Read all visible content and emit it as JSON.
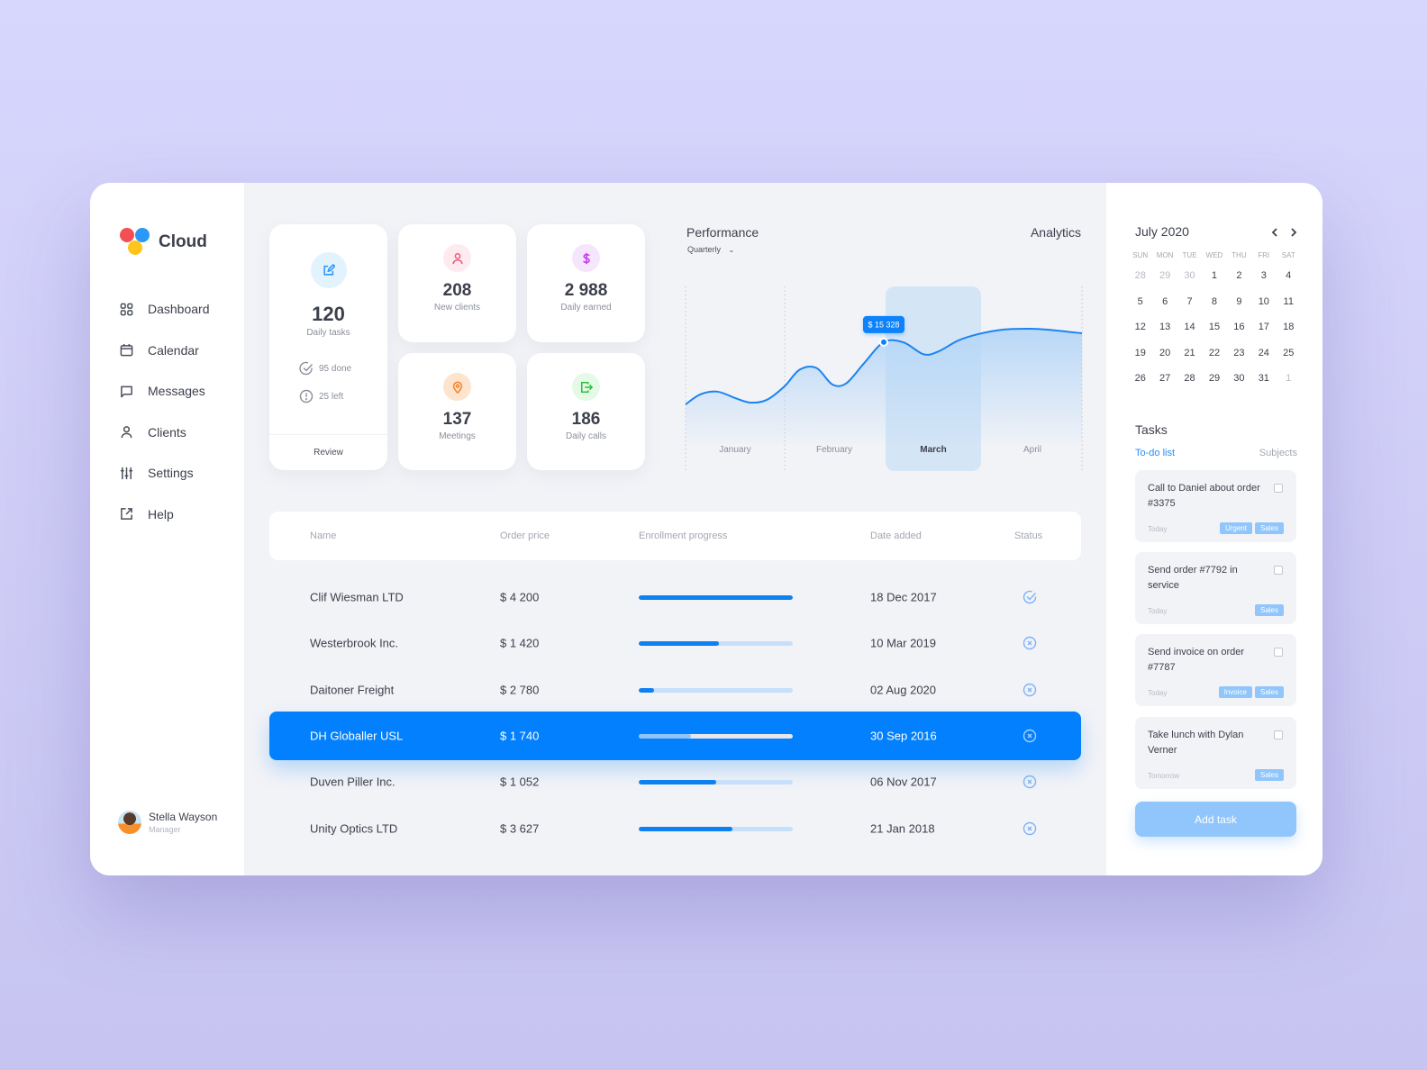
{
  "app": {
    "name": "Cloud"
  },
  "sidebar": {
    "items": [
      {
        "label": "Dashboard",
        "icon": "grid-icon"
      },
      {
        "label": "Calendar",
        "icon": "calendar-icon"
      },
      {
        "label": "Messages",
        "icon": "message-icon"
      },
      {
        "label": "Clients",
        "icon": "user-icon"
      },
      {
        "label": "Settings",
        "icon": "sliders-icon"
      },
      {
        "label": "Help",
        "icon": "external-link-icon"
      }
    ],
    "user": {
      "name": "Stella Wayson",
      "role": "Manager"
    }
  },
  "stats": {
    "daily_tasks": {
      "value": "120",
      "label": "Daily tasks",
      "done": "95 done",
      "left": "25 left",
      "review": "Review"
    },
    "new_clients": {
      "value": "208",
      "label": "New clients"
    },
    "daily_earned": {
      "value": "2 988",
      "label": "Daily earned"
    },
    "meetings": {
      "value": "137",
      "label": "Meetings"
    },
    "daily_calls": {
      "value": "186",
      "label": "Daily calls"
    }
  },
  "colors": {
    "accent": "#0380fd",
    "tag": "#90c6fb",
    "tasks_icon_bg": "#e3f3fe",
    "clients_icon_bg": "#fdebf0",
    "earned_icon_bg": "#f6e6fd",
    "meetings_icon_bg": "#fde4cf",
    "calls_icon_bg": "#e5fae6"
  },
  "performance": {
    "title": "Performance",
    "period": "Quarterly",
    "analytics_label": "Analytics",
    "tooltip": "$ 15 328"
  },
  "chart_data": {
    "type": "area",
    "title": "Performance",
    "categories": [
      "January",
      "February",
      "March",
      "April"
    ],
    "highlighted": "March",
    "highlight_value": 15328,
    "x": [
      0,
      0.15,
      0.32,
      0.5,
      0.65,
      0.82,
      1.0,
      1.15,
      1.32,
      1.48,
      1.62,
      1.8,
      2.0,
      2.2,
      2.4,
      2.55,
      2.75,
      2.95,
      3.2,
      3.45,
      3.65,
      4.0
    ],
    "values": [
      8500,
      9600,
      9900,
      9200,
      8700,
      9000,
      10500,
      12300,
      12500,
      10700,
      10800,
      13000,
      15328,
      15300,
      14000,
      14300,
      15500,
      16200,
      16700,
      16800,
      16700,
      16300
    ],
    "ylim": [
      0,
      20000
    ],
    "xlabel": "",
    "ylabel": "",
    "grid": false
  },
  "table": {
    "headers": [
      "Name",
      "Order price",
      "Enrollment progress",
      "Date added",
      "Status"
    ],
    "rows": [
      {
        "name": "Clif Wiesman LTD",
        "price": "$ 4 200",
        "progress": 1.0,
        "date": "18 Dec 2017",
        "status": "done",
        "selected": false
      },
      {
        "name": "Westerbrook Inc.",
        "price": "$ 1 420",
        "progress": 0.52,
        "date": "10 Mar 2019",
        "status": "cancelled",
        "selected": false
      },
      {
        "name": "Daitoner Freight",
        "price": "$ 2 780",
        "progress": 0.1,
        "date": "02 Aug 2020",
        "status": "cancelled",
        "selected": false
      },
      {
        "name": "DH Globaller USL",
        "price": "$ 1 740",
        "progress": 0.34,
        "date": "30 Sep 2016",
        "status": "cancelled",
        "selected": true
      },
      {
        "name": "Duven Piller Inc.",
        "price": "$ 1 052",
        "progress": 0.5,
        "date": "06 Nov 2017",
        "status": "cancelled",
        "selected": false
      },
      {
        "name": "Unity Optics LTD",
        "price": "$ 3 627",
        "progress": 0.61,
        "date": "21 Jan 2018",
        "status": "cancelled",
        "selected": false
      }
    ]
  },
  "calendar": {
    "title": "July 2020",
    "weekdays": [
      "SUN",
      "MON",
      "TUE",
      "WED",
      "THU",
      "FRI",
      "SAT"
    ],
    "weeks": [
      [
        {
          "d": "28",
          "m": true
        },
        {
          "d": "29",
          "m": true
        },
        {
          "d": "30",
          "m": true
        },
        {
          "d": "1"
        },
        {
          "d": "2"
        },
        {
          "d": "3"
        },
        {
          "d": "4"
        }
      ],
      [
        {
          "d": "5"
        },
        {
          "d": "6"
        },
        {
          "d": "7"
        },
        {
          "d": "8"
        },
        {
          "d": "9"
        },
        {
          "d": "10"
        },
        {
          "d": "11"
        }
      ],
      [
        {
          "d": "12"
        },
        {
          "d": "13"
        },
        {
          "d": "14"
        },
        {
          "d": "15"
        },
        {
          "d": "16"
        },
        {
          "d": "17"
        },
        {
          "d": "18"
        }
      ],
      [
        {
          "d": "19"
        },
        {
          "d": "20"
        },
        {
          "d": "21"
        },
        {
          "d": "22"
        },
        {
          "d": "23"
        },
        {
          "d": "24"
        },
        {
          "d": "25"
        }
      ],
      [
        {
          "d": "26"
        },
        {
          "d": "27"
        },
        {
          "d": "28"
        },
        {
          "d": "29"
        },
        {
          "d": "30"
        },
        {
          "d": "31"
        },
        {
          "d": "1",
          "m": true
        }
      ]
    ]
  },
  "tasks": {
    "title": "Tasks",
    "tab_todo": "To-do list",
    "tab_subjects": "Subjects",
    "items": [
      {
        "text": "Call to Daniel about order #3375",
        "when": "Today",
        "tags": [
          "Urgent",
          "Sales"
        ]
      },
      {
        "text": "Send order #7792 in service",
        "when": "Today",
        "tags": [
          "Sales"
        ]
      },
      {
        "text": "Send invoice on order #7787",
        "when": "Today",
        "tags": [
          "Invoice",
          "Sales"
        ]
      },
      {
        "text": "Take lunch with Dylan Verner",
        "when": "Tomorrow",
        "tags": [
          "Sales"
        ]
      }
    ],
    "add_label": "Add task"
  }
}
